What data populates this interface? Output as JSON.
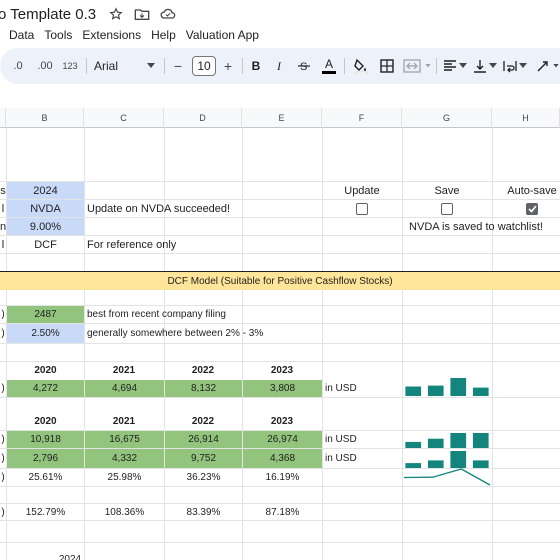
{
  "app": {
    "title": "o Template 0.3",
    "title_icons": [
      "star-icon",
      "move-icon",
      "cloud-icon"
    ]
  },
  "menu": [
    "Data",
    "Tools",
    "Extensions",
    "Help",
    "Valuation App"
  ],
  "toolbar": {
    "dec_decrease": ".0",
    "dec_increase": ".00",
    "number_format": "123",
    "font": "Arial",
    "font_size": "10",
    "minus": "−",
    "plus": "+",
    "bold": "B",
    "italic": "I",
    "underline": "A"
  },
  "columns": [
    "B",
    "C",
    "D",
    "E",
    "F",
    "G",
    "H"
  ],
  "rows": {
    "r1": {
      "a": "s",
      "b": "2024",
      "f": "Update",
      "g": "Save",
      "h": "Auto-save"
    },
    "r2": {
      "a": "l",
      "b": "NVDA",
      "c": "Update on NVDA succeeded!",
      "h_checked": true
    },
    "r3": {
      "a": "n",
      "b": "9.00%",
      "g": "NVDA is saved to watchlist!"
    },
    "r4": {
      "a": "l",
      "b": "DCF",
      "c": "For reference only"
    },
    "banner": "DCF Model (Suitable for Positive Cashflow Stocks)",
    "r6": {
      "a": ")",
      "b": "2487",
      "c": "best from recent company filing"
    },
    "r7": {
      "a": ")",
      "b": "2.50%",
      "c": "generally somewhere between 2% - 3%"
    },
    "years1": [
      "2020",
      "2021",
      "2022",
      "2023"
    ],
    "r9": {
      "a": ")",
      "vals": [
        "4,272",
        "4,694",
        "8,132",
        "3,808"
      ],
      "unit": "in USD"
    },
    "years2": [
      "2020",
      "2021",
      "2022",
      "2023"
    ],
    "r11": {
      "a": ")",
      "vals": [
        "10,918",
        "16,675",
        "26,914",
        "26,974"
      ],
      "unit": "in USD"
    },
    "r12": {
      "a": ")",
      "vals": [
        "2,796",
        "4,332",
        "9,752",
        "4,368"
      ],
      "unit": "in USD"
    },
    "r13": {
      "a": ")",
      "vals": [
        "25.61%",
        "25.98%",
        "36.23%",
        "16.19%"
      ]
    },
    "r15": {
      "a": ")",
      "vals": [
        "152.79%",
        "108.36%",
        "83.39%",
        "87.18%"
      ]
    },
    "partial": "2024"
  },
  "sparklines": {
    "color": "#14857d",
    "r9": [
      4272,
      4694,
      8132,
      3808
    ],
    "r11": [
      10918,
      16675,
      26914,
      26974
    ],
    "r12": [
      2796,
      4332,
      9752,
      4368
    ],
    "r13": [
      25.61,
      25.98,
      36.23,
      16.19
    ]
  }
}
